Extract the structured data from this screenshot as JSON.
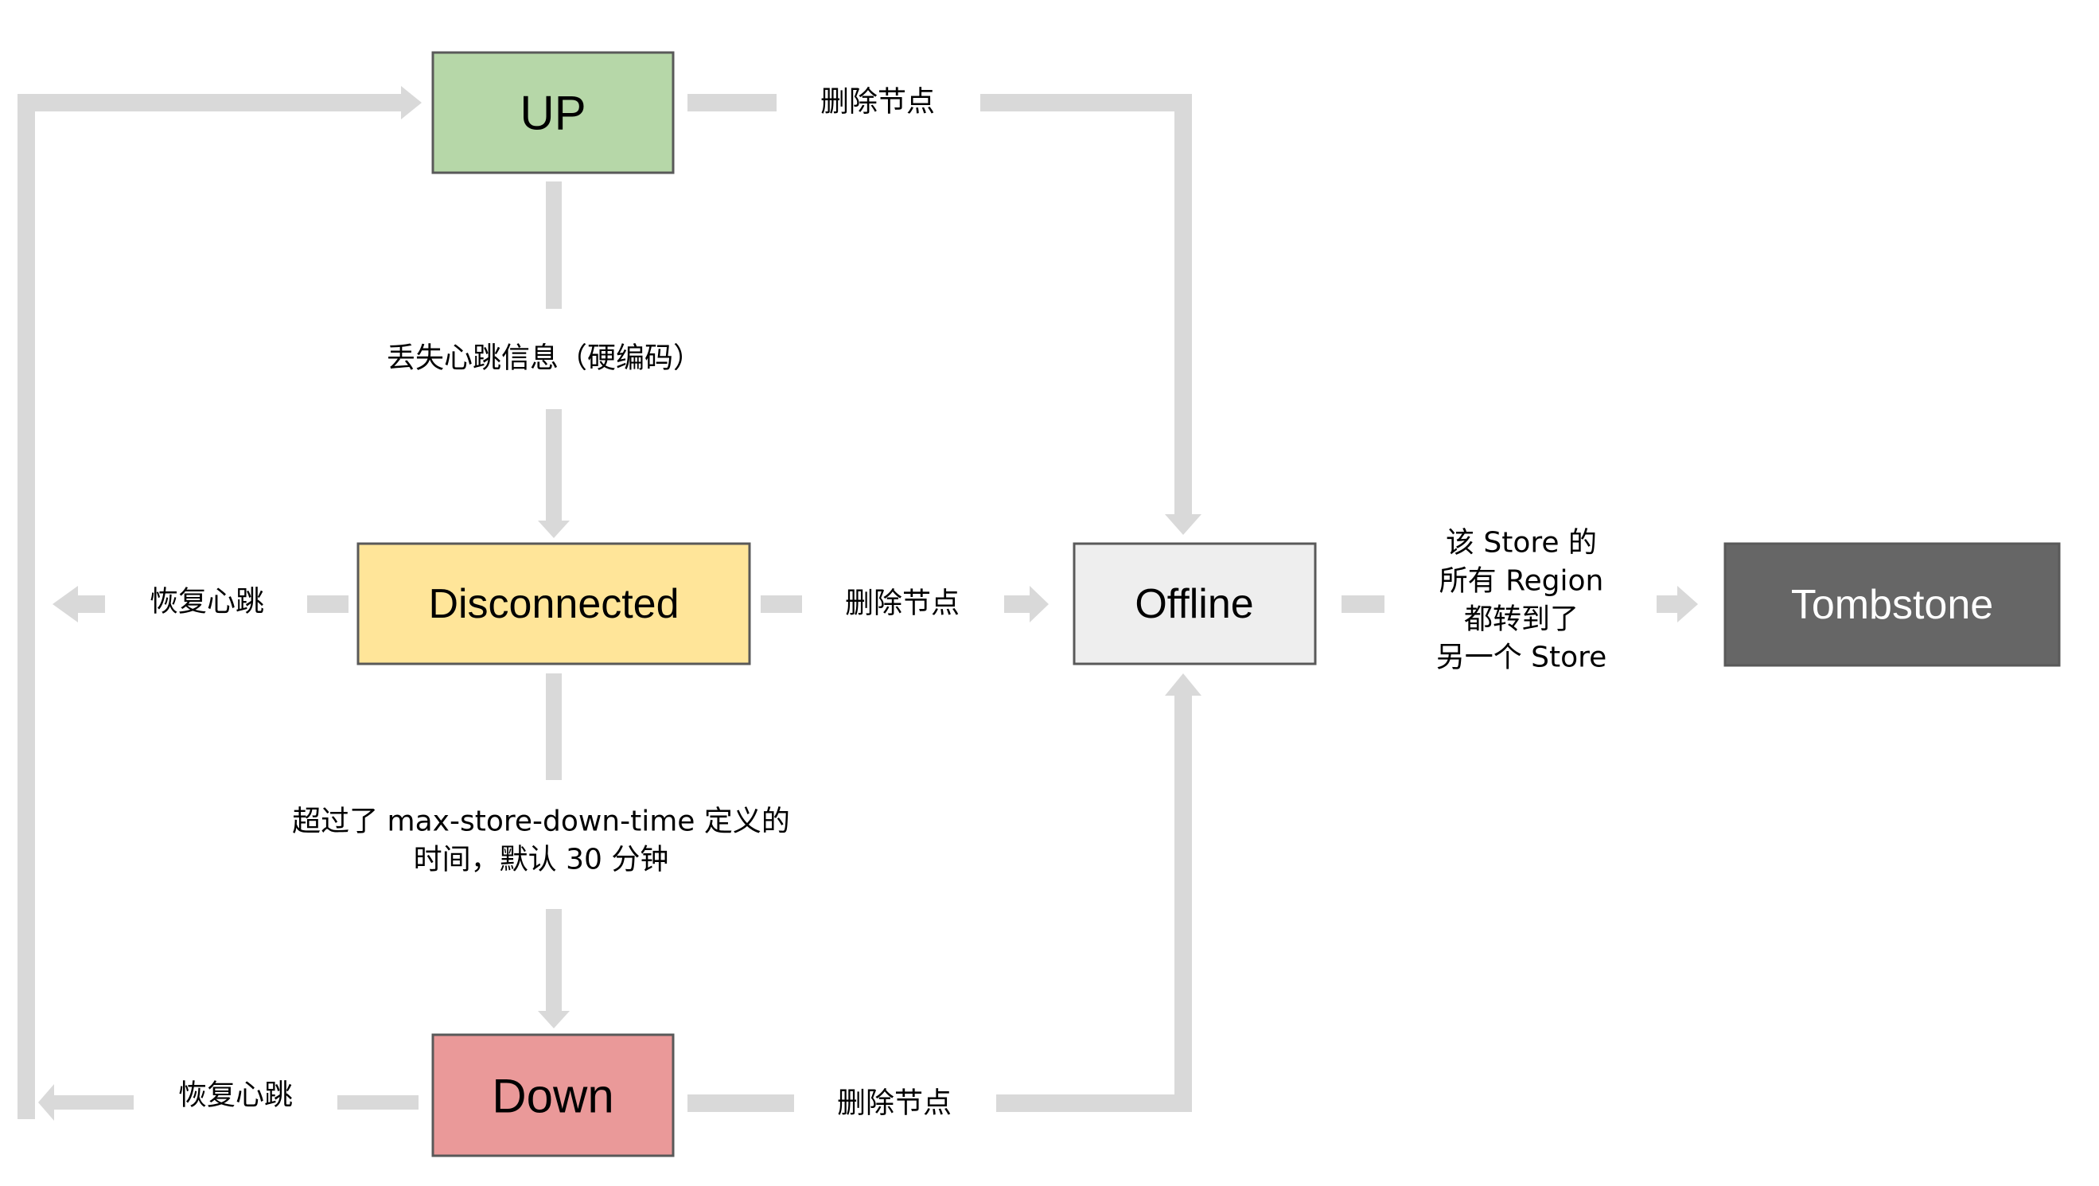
{
  "diagram": {
    "title": "",
    "nodes": [
      {
        "id": "up",
        "label": "UP",
        "fill": "#b6d7a8",
        "text_color": "#000000"
      },
      {
        "id": "disconnected",
        "label": "Disconnected",
        "fill": "#ffe599",
        "text_color": "#000000"
      },
      {
        "id": "down",
        "label": "Down",
        "fill": "#ea9999",
        "text_color": "#000000"
      },
      {
        "id": "offline",
        "label": "Offline",
        "fill": "#eeeeee",
        "text_color": "#000000"
      },
      {
        "id": "tombstone",
        "label": "Tombstone",
        "fill": "#666666",
        "text_color": "#ffffff"
      }
    ],
    "edges": [
      {
        "id": "up-to-disconnected",
        "from": "up",
        "to": "disconnected",
        "label_lines": [
          "丢失心跳信息（硬编码）"
        ]
      },
      {
        "id": "disconnected-to-down",
        "from": "disconnected",
        "to": "down",
        "label_lines": [
          "超过了 max-store-down-time  定义的",
          "时间，默认 30 分钟"
        ]
      },
      {
        "id": "disconnected-to-up",
        "from": "disconnected",
        "to": "up",
        "label_lines": [
          "恢复心跳"
        ]
      },
      {
        "id": "down-to-up",
        "from": "down",
        "to": "up",
        "label_lines": [
          "恢复心跳"
        ]
      },
      {
        "id": "up-to-offline",
        "from": "up",
        "to": "offline",
        "label_lines": [
          "删除节点"
        ]
      },
      {
        "id": "disconnected-to-offline",
        "from": "disconnected",
        "to": "offline",
        "label_lines": [
          "删除节点"
        ]
      },
      {
        "id": "down-to-offline",
        "from": "down",
        "to": "offline",
        "label_lines": [
          "删除节点"
        ]
      },
      {
        "id": "offline-to-tombstone",
        "from": "offline",
        "to": "tombstone",
        "label_lines": [
          "该 Store 的",
          "所有 Region",
          "都转到了",
          "另一个 Store"
        ]
      }
    ],
    "colors": {
      "connector": "#d9d9d9",
      "node_border": "#595959"
    }
  }
}
